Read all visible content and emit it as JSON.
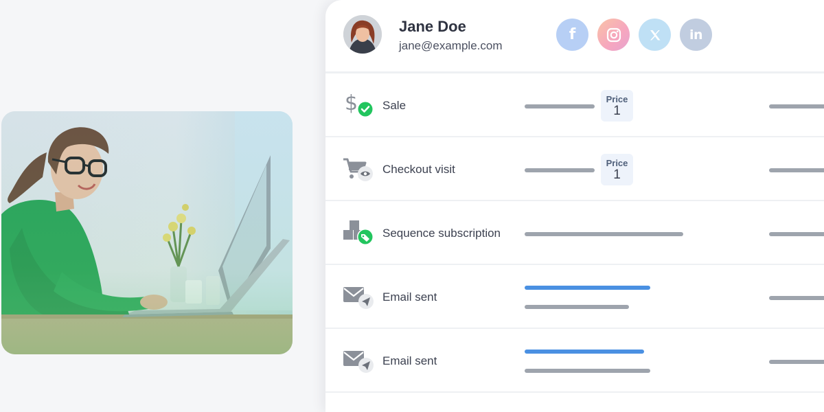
{
  "user": {
    "name": "Jane Doe",
    "email": "jane@example.com"
  },
  "socials": [
    {
      "name": "facebook",
      "glyph": "f",
      "color": "#b7cff5"
    },
    {
      "name": "instagram",
      "glyph": "instagram-icon",
      "color": "#f6a6bf"
    },
    {
      "name": "x",
      "glyph": "𝕏",
      "color": "#bfe0f5"
    },
    {
      "name": "linkedin",
      "glyph": "in",
      "color": "#c1cde0"
    }
  ],
  "activities": [
    {
      "label": "Sale",
      "icon": "dollar-check-icon",
      "price_label": "Price",
      "price_value": "1"
    },
    {
      "label": "Checkout visit",
      "icon": "cart-eye-icon",
      "price_label": "Price",
      "price_value": "1"
    },
    {
      "label": "Sequence subscription",
      "icon": "blocks-tag-icon"
    },
    {
      "label": "Email sent",
      "icon": "envelope-send-icon"
    },
    {
      "label": "Email sent",
      "icon": "envelope-send-icon"
    }
  ],
  "colors": {
    "accent_blue": "#4a90e2",
    "success_green": "#22c55e",
    "placeholder_bar": "#9ea4ad"
  }
}
